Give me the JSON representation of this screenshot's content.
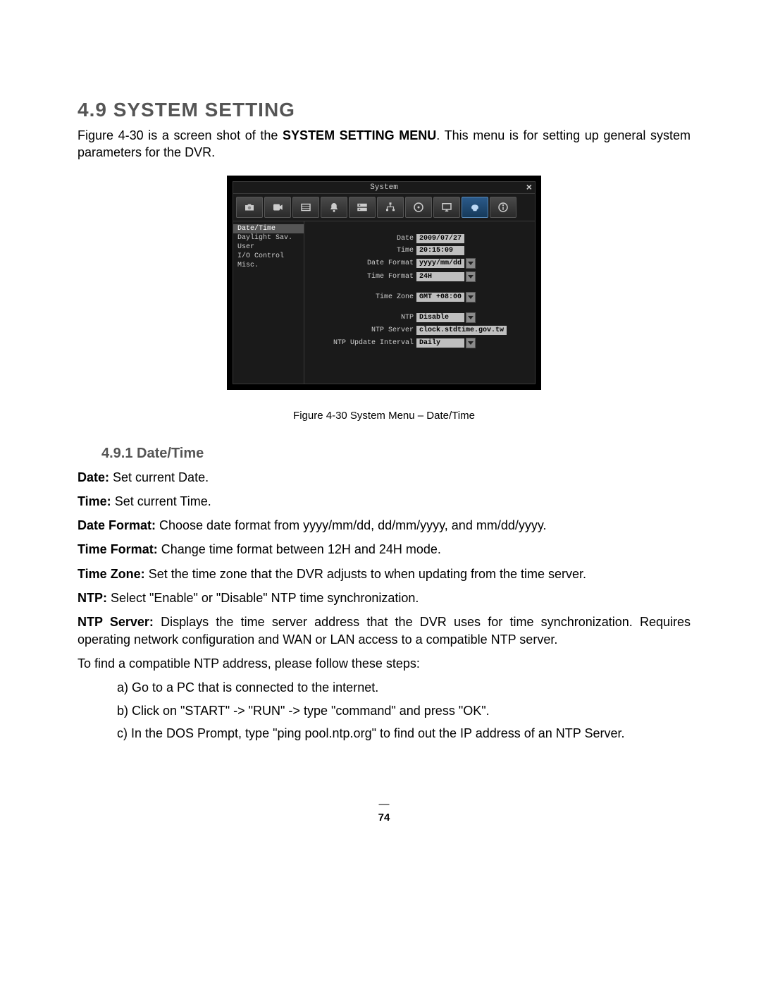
{
  "heading": "4.9  SYSTEM SETTING",
  "intro_pre": "Figure 4-30 is a screen shot of the ",
  "intro_bold": "SYSTEM SETTING MENU",
  "intro_post": ". This menu is for setting up general system parameters for the DVR.",
  "dvr": {
    "title": "System",
    "close": "×",
    "sidebar": {
      "items": [
        "Date/Time",
        "Daylight Sav.",
        "User",
        "I/O Control",
        "Misc."
      ]
    },
    "fields": {
      "date_label": "Date",
      "date_value": "2009/07/27",
      "time_label": "Time",
      "time_value": "20:15:09",
      "datefmt_label": "Date Format",
      "datefmt_value": "yyyy/mm/dd",
      "timefmt_label": "Time Format",
      "timefmt_value": "24H",
      "tz_label": "Time Zone",
      "tz_value": "GMT +08:00",
      "ntp_label": "NTP",
      "ntp_value": "Disable",
      "ntpsrv_label": "NTP Server",
      "ntpsrv_value": "clock.stdtime.gov.tw",
      "ntpupd_label": "NTP Update Interval",
      "ntpupd_value": "Daily"
    }
  },
  "caption": "Figure 4-30   System Menu – Date/Time",
  "subheading": "4.9.1  Date/Time",
  "defs": {
    "date_b": "Date:",
    "date_t": " Set current Date.",
    "time_b": "Time:",
    "time_t": " Set current Time.",
    "datefmt_b": "Date Format:",
    "datefmt_t": " Choose date format from yyyy/mm/dd, dd/mm/yyyy, and mm/dd/yyyy.",
    "timefmt_b": "Time Format:",
    "timefmt_t": " Change time format between 12H and 24H mode.",
    "tz_b": "Time Zone:",
    "tz_t": " Set the time zone that the DVR adjusts to when updating from the time server.",
    "ntp_b": "NTP:",
    "ntp_t": " Select \"Enable\" or \"Disable\" NTP time synchronization.",
    "ntpsrv_b": "NTP Server:",
    "ntpsrv_t": " Displays the time server address that the DVR uses for time synchronization. Requires operating network configuration and WAN or LAN access to a compatible NTP server."
  },
  "findntp": "To find a compatible NTP address, please follow these steps:",
  "steps": {
    "a": "a) Go to a PC that is connected to the internet.",
    "b": "b) Click on \"START\" -> \"RUN\" -> type \"command\" and press \"OK\".",
    "c": "c) In the DOS Prompt, type \"ping pool.ntp.org\" to find out the IP address of an NTP Server."
  },
  "page_dash": "—",
  "page_num": "74"
}
